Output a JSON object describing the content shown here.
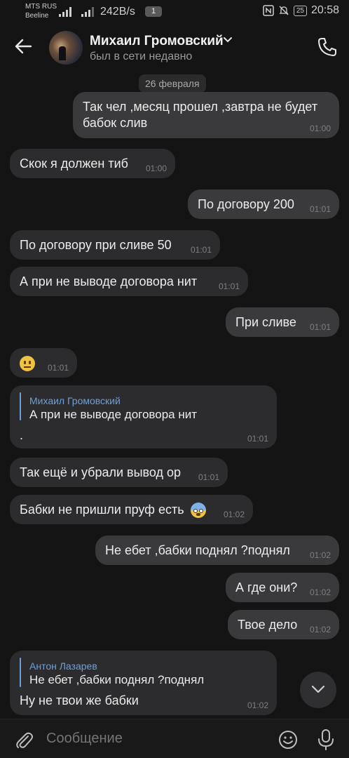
{
  "status_bar": {
    "carrier1": "MTS RUS",
    "carrier2": "Beeline",
    "speed": "242B/s",
    "notif_count": "1",
    "battery": "25",
    "time": "20:58"
  },
  "header": {
    "name": "Михаил Громовский",
    "status": "был в сети недавно"
  },
  "date_separator": "26 февраля",
  "messages": [
    {
      "dir": "out",
      "text1": "Так чел ,месяц прошел ,завтра не будет",
      "text2": "бабок слив",
      "time": "01:00"
    },
    {
      "dir": "in",
      "text": "Скок я должен тиб",
      "time": "01:00"
    },
    {
      "dir": "out",
      "text": "По договору 200",
      "time": "01:01"
    },
    {
      "dir": "in",
      "text": "По договору при сливе 50",
      "time": "01:01"
    },
    {
      "dir": "in",
      "text": "А при не выводе договора нит",
      "time": "01:01"
    },
    {
      "dir": "out",
      "text": "При сливе",
      "time": "01:01"
    },
    {
      "dir": "in",
      "emoji": "neutral-face",
      "time": "01:01"
    },
    {
      "dir": "in",
      "reply_name": "Михаил Громовский",
      "reply_text": "А при не выводе договора нит",
      "text": ".",
      "time": "01:01"
    },
    {
      "dir": "in",
      "text": "Так ещё и убрали вывод ор",
      "time": "01:01"
    },
    {
      "dir": "in",
      "text": "Бабки не пришли пруф есть",
      "emoji": "fearful-face",
      "time": "01:02"
    },
    {
      "dir": "out",
      "text": "Не ебет ,бабки поднял ?поднял",
      "time": "01:02"
    },
    {
      "dir": "out",
      "text": "А где они?",
      "time": "01:02"
    },
    {
      "dir": "out",
      "text": "Твое дело",
      "time": "01:02"
    },
    {
      "dir": "in",
      "reply_name": "Антон Лазарев",
      "reply_text": "Не ебет ,бабки поднял ?поднял",
      "text": "Ну не твои же бабки",
      "time": "01:02"
    }
  ],
  "composer": {
    "placeholder": "Сообщение"
  },
  "colors": {
    "background": "#141414",
    "bubble_in": "#2c2c2e",
    "bubble_out": "#3a3a3c",
    "reply_accent": "#6f9fd8"
  }
}
